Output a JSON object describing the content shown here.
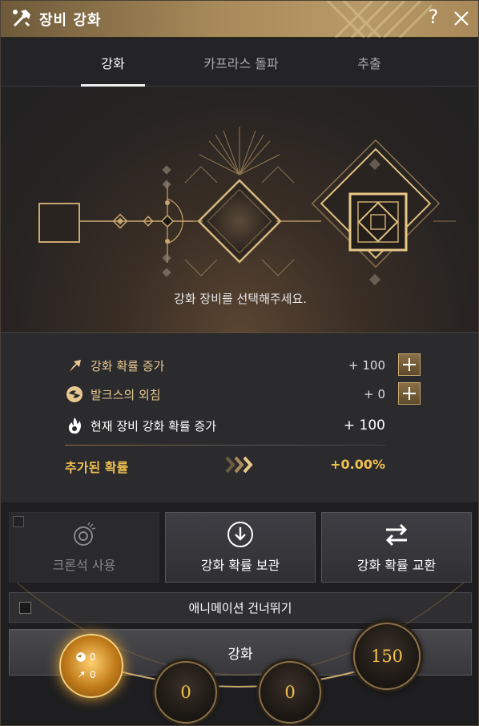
{
  "window": {
    "title": "장비 강화",
    "help_label": "?"
  },
  "tabs": [
    {
      "label": "강화",
      "active": true
    },
    {
      "label": "카프라스 돌파",
      "active": false
    },
    {
      "label": "추출",
      "active": false
    }
  ],
  "visual": {
    "message": "강화 장비를 선택해주세요."
  },
  "stats": {
    "rows": [
      {
        "icon": "arrow-up-icon",
        "label": "강화 확률 증가",
        "value": "+ 100"
      },
      {
        "icon": "valks-orb-icon",
        "label": "발크스의 외침",
        "value": "+ 0"
      },
      {
        "icon": "flame-icon",
        "label": "현재 장비 강화 확률 증가",
        "value": "+ 100"
      }
    ],
    "added": {
      "label": "추가된 확률",
      "value": "+0.00%"
    }
  },
  "actions": {
    "cron_label": "크론석 사용",
    "store_label": "강화 확률 보관",
    "exchange_label": "강화 확률 교환",
    "skip_label": "애니메이션 건너뛰기",
    "enhance_label": "강화"
  },
  "orbs": {
    "gold_valks": "0",
    "gold_arrow": "0",
    "orb_left": "0",
    "orb_mid": "0",
    "orb_right": "150"
  },
  "colors": {
    "accent": "#f0c050",
    "gold": "#c8a870",
    "title_bar": "#a88a5a"
  }
}
